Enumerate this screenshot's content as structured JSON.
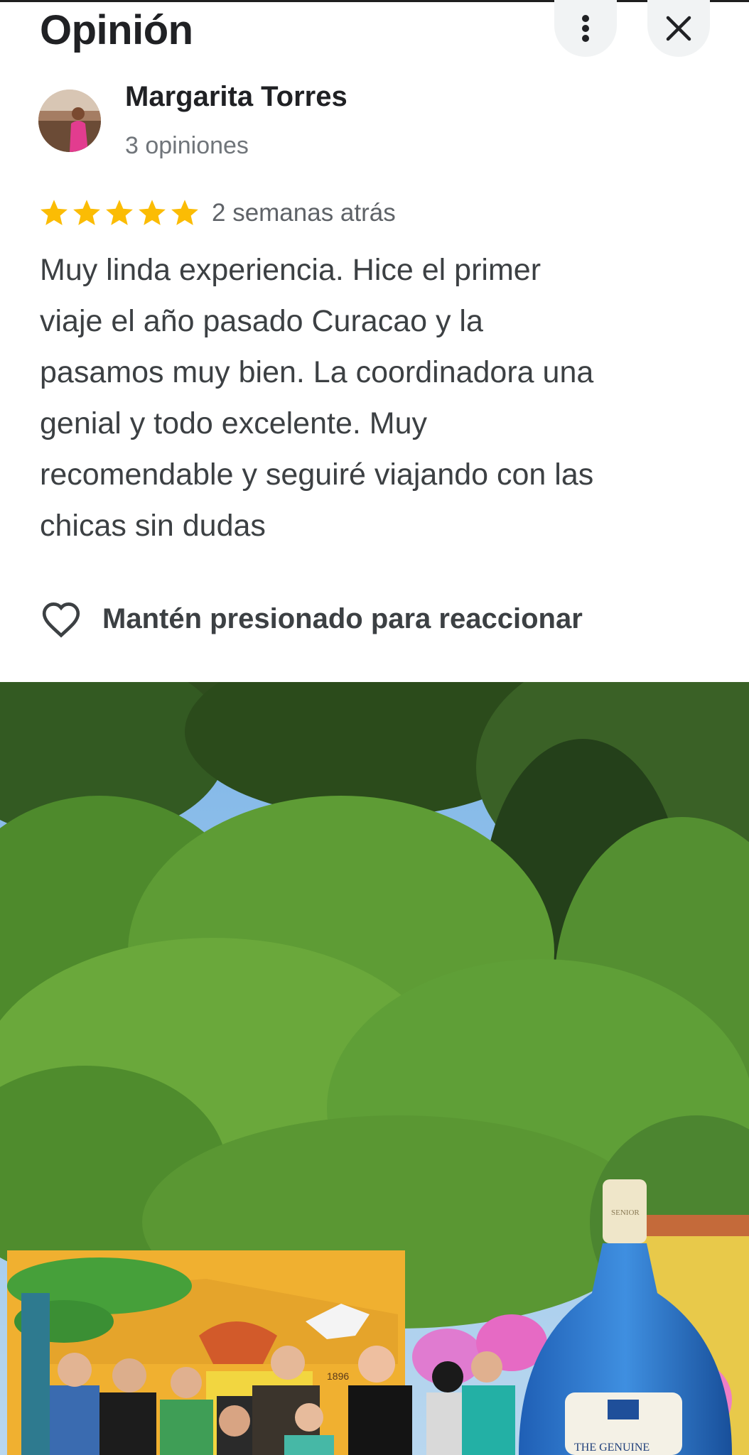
{
  "header": {
    "title": "Opinión"
  },
  "review": {
    "author": "Margarita Torres",
    "review_count": "3 opiniones",
    "rating": 5,
    "rating_max": 5,
    "date": "2 semanas atrás",
    "text": "Muy linda experiencia. Hice el primer\nviaje el año pasado  Curacao y la\npasamos muy bien. La coordinadora una\ngenial y todo excelente. Muy\nrecomendable y seguiré viajando con las\nchicas sin dudas"
  },
  "reaction": {
    "label": "Mantén presionado para reaccionar"
  },
  "photo": {
    "bottle_label_top": "SENIOR",
    "bottle_label_bottom": "THE GENUINE",
    "sign_text": "1896"
  },
  "colors": {
    "star": "#fbbc04",
    "text_primary": "#202124",
    "text_secondary": "#70757a",
    "button_bg": "#f1f3f4"
  },
  "icons": {
    "menu": "more-vert-icon",
    "close": "close-icon",
    "react": "heart-outline-icon",
    "star": "star-icon"
  }
}
